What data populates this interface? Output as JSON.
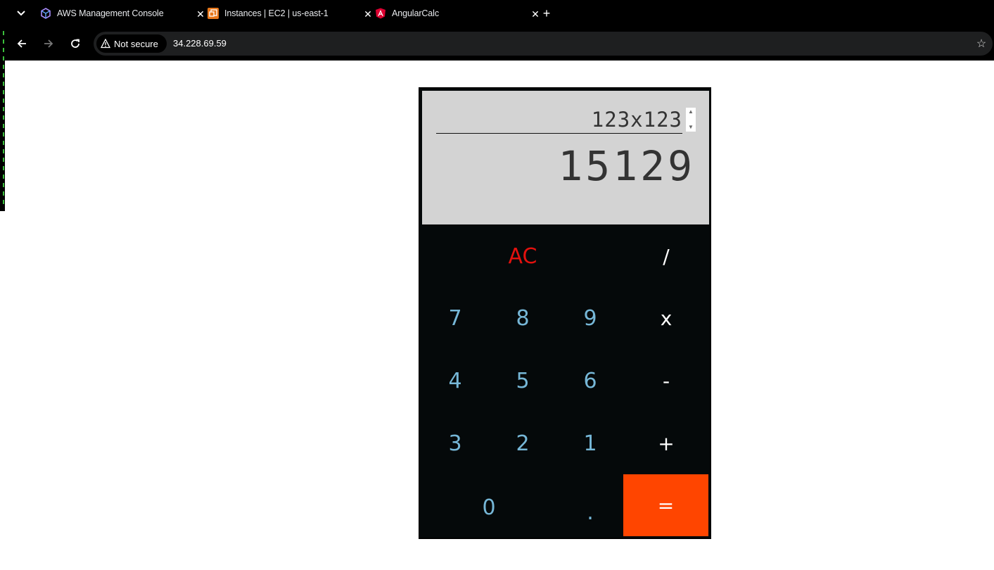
{
  "browser": {
    "tabs": [
      {
        "title": "AWS Management Console",
        "icon": "aws-cube-icon"
      },
      {
        "title": "Instances | EC2 | us-east-1",
        "icon": "ec2-icon"
      },
      {
        "title": "AngularCalc",
        "icon": "angular-icon"
      }
    ],
    "security_label": "Not secure",
    "url": "34.228.69.59"
  },
  "calculator": {
    "expression": "123x123",
    "result": "15129",
    "keys": {
      "clear": "AC",
      "divide": "/",
      "multiply": "x",
      "subtract": "-",
      "add": "+",
      "equals": "=",
      "decimal": ".",
      "d0": "0",
      "d1": "1",
      "d2": "2",
      "d3": "3",
      "d4": "4",
      "d5": "5",
      "d6": "6",
      "d7": "7",
      "d8": "8",
      "d9": "9"
    }
  },
  "colors": {
    "equals_bg": "#ff4500",
    "clear_text": "#e3110e",
    "digit_text": "#76b7d7",
    "keypad_bg": "#05090a",
    "display_bg": "#d3d3d3"
  }
}
